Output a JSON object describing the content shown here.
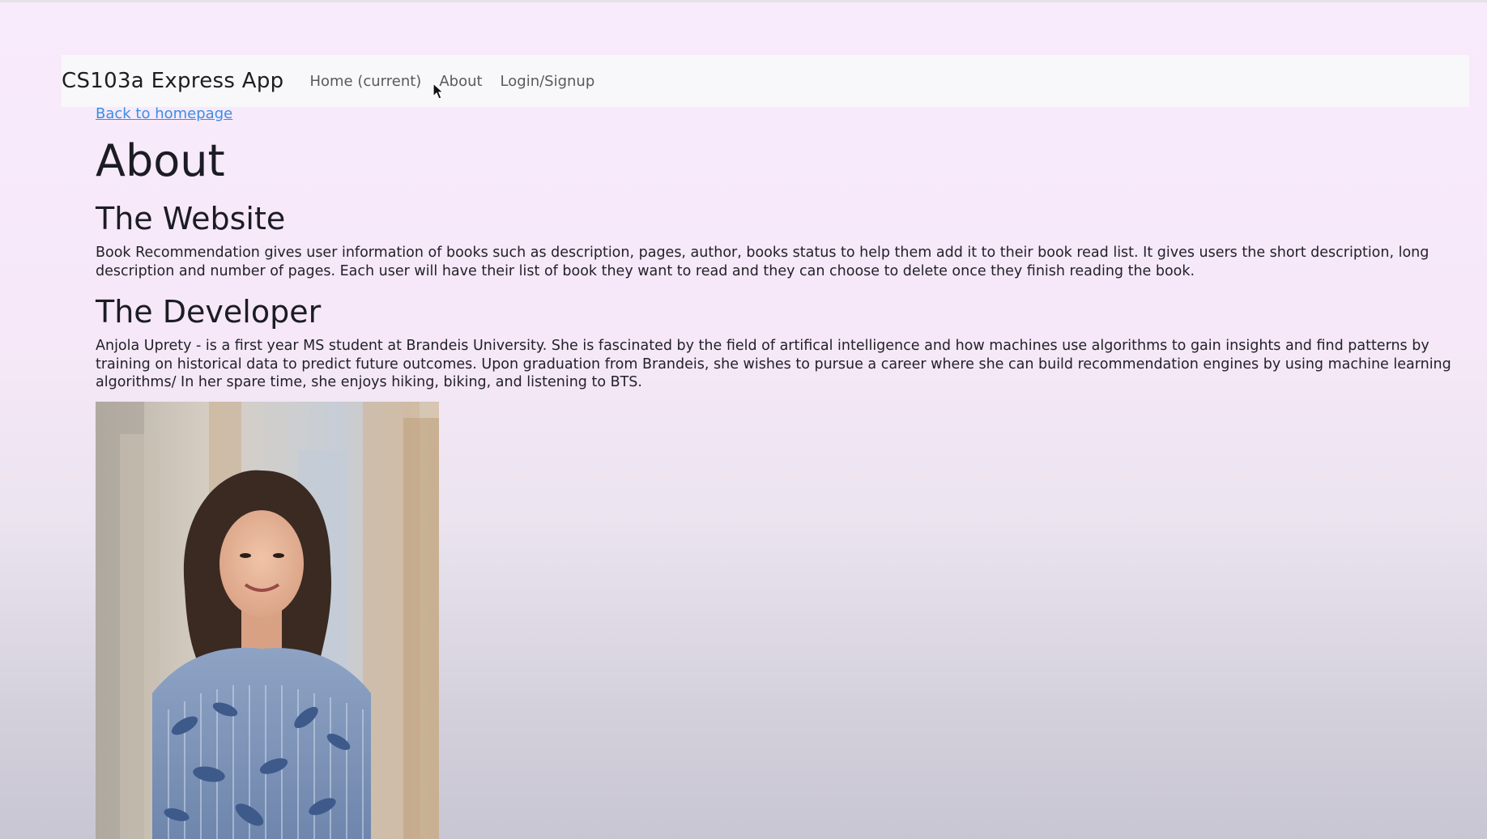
{
  "navbar": {
    "brand": "CS103a Express App",
    "links": [
      {
        "label": "Home (current)"
      },
      {
        "label": "About"
      },
      {
        "label": "Login/Signup"
      }
    ]
  },
  "main": {
    "back_link": "Back to homepage",
    "title": "About",
    "sections": [
      {
        "heading": "The Website",
        "text": "Book Recommendation gives user information of books such as description, pages, author, books status to help them add it to their book read list. It gives users the short description, long description and number of pages. Each user will have their list of book they want to read and they can choose to delete once they finish reading the book."
      },
      {
        "heading": "The Developer",
        "text": "Anjola Uprety - is a first year MS student at Brandeis University. She is fascinated by the field of artifical intelligence and how machines use algorithms to gain insights and find patterns by training on historical data to predict future outcomes. Upon graduation from Brandeis, she wishes to pursue a career where she can build recommendation engines by using machine learning algorithms/ In her spare time, she enjoys hiking, biking, and listening to BTS."
      }
    ]
  },
  "colors": {
    "page_background": "#f8ebfb",
    "navbar_background": "#f8f7f9",
    "link": "#3a8ee6"
  },
  "icons": {
    "cursor": "mouse-pointer-icon"
  }
}
